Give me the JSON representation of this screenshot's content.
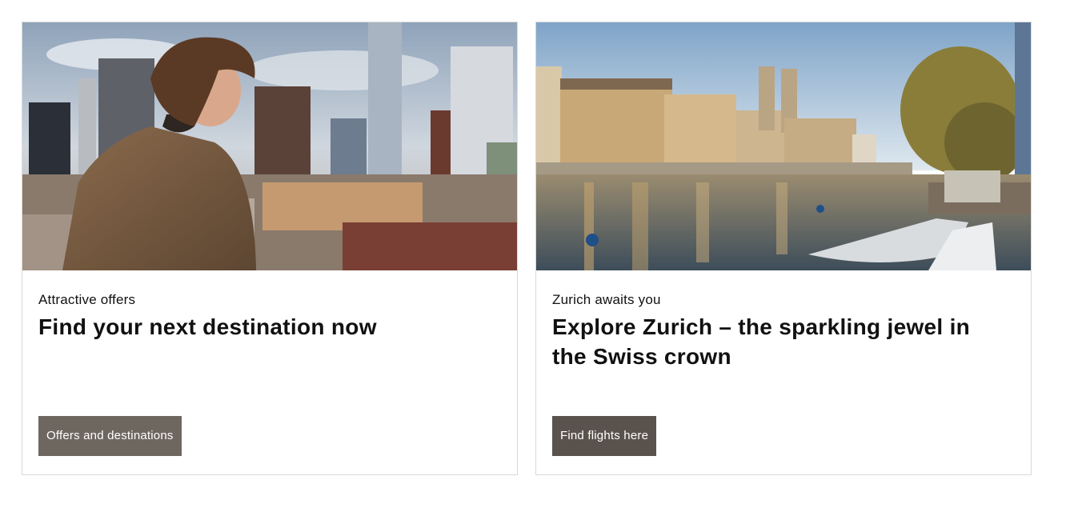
{
  "cards": [
    {
      "eyebrow": "Attractive offers",
      "headline": "Find your next destination now",
      "cta_label": "Offers and destinations",
      "image_alt": "Man looking over a city skyline"
    },
    {
      "eyebrow": "Zurich awaits you",
      "headline": "Explore Zurich – the sparkling jewel in the Swiss crown",
      "cta_label": "Find flights here",
      "image_alt": "Zurich old town on the river Limmat"
    }
  ],
  "colors": {
    "cta_tan": "#6e6760",
    "cta_dark": "#5a534d",
    "card_border": "#d9d9d9"
  }
}
